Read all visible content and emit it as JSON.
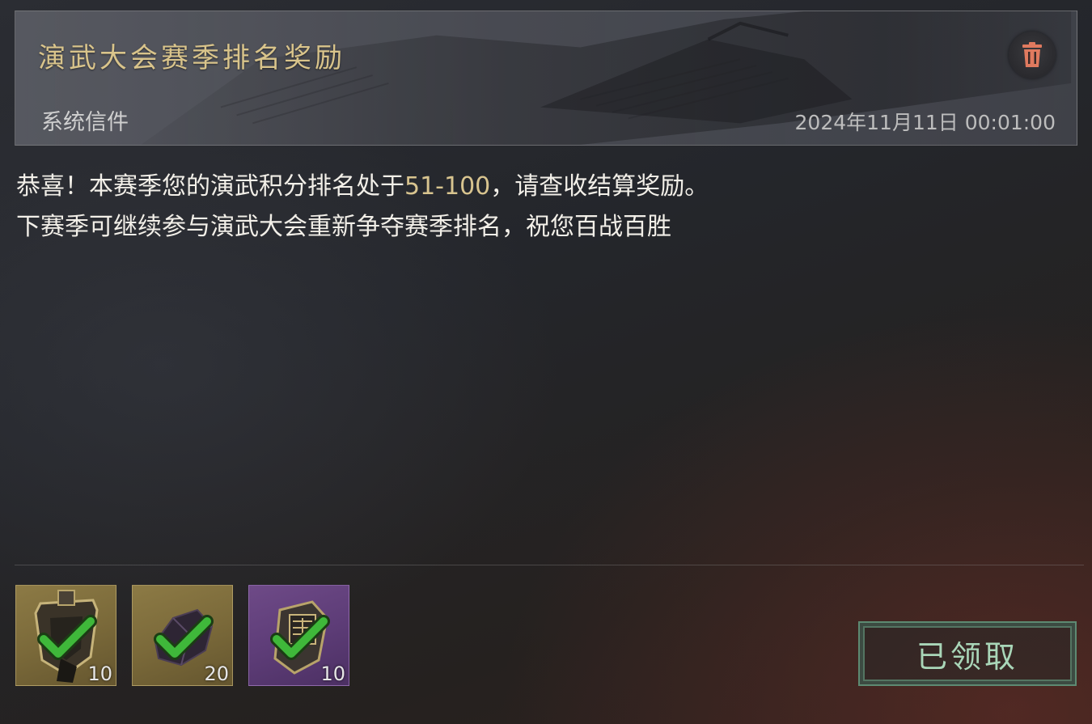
{
  "mail": {
    "title": "演武大会赛季排名奖励",
    "sender": "系统信件",
    "timestamp": "2024年11月11日  00:01:00",
    "delete_icon": "trash-icon"
  },
  "message": {
    "line1_prefix": "恭喜！本赛季您的演武积分排名处于",
    "line1_highlight": "51-100",
    "line1_suffix": "，请查收结算奖励。",
    "line2": "下赛季可继续参与演武大会重新争夺赛季排名，祝您百战百胜",
    "highlight_color": "#d8c48f"
  },
  "rewards": [
    {
      "icon": "token-badge-icon",
      "quantity": "10",
      "rarity": "gold",
      "claimed": true
    },
    {
      "icon": "dark-ore-icon",
      "quantity": "20",
      "rarity": "gold",
      "claimed": true
    },
    {
      "icon": "scroll-badge-icon",
      "quantity": "10",
      "rarity": "purple",
      "claimed": true
    }
  ],
  "claim_button": {
    "label": "已领取"
  },
  "colors": {
    "title_gold": "#d9c48b",
    "claimed_green": "#a9d6b8",
    "check_green": "#3fb83a"
  }
}
